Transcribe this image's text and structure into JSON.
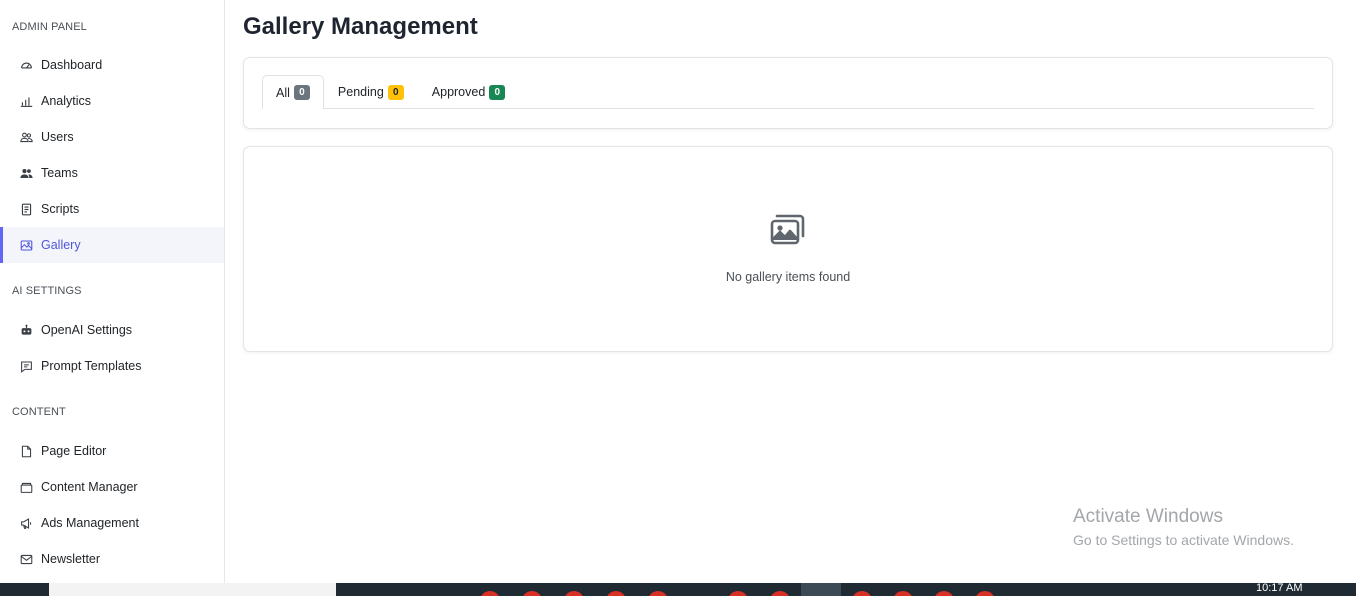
{
  "sidebar": {
    "sections": [
      {
        "title": "ADMIN PANEL"
      },
      {
        "title": "AI SETTINGS"
      },
      {
        "title": "CONTENT"
      }
    ],
    "items": [
      {
        "label": "Dashboard",
        "icon": "dashboard-icon"
      },
      {
        "label": "Analytics",
        "icon": "analytics-icon"
      },
      {
        "label": "Users",
        "icon": "users-icon"
      },
      {
        "label": "Teams",
        "icon": "teams-icon"
      },
      {
        "label": "Scripts",
        "icon": "scripts-icon"
      },
      {
        "label": "Gallery",
        "icon": "gallery-icon",
        "active": true
      },
      {
        "label": "OpenAI Settings",
        "icon": "robot-icon"
      },
      {
        "label": "Prompt Templates",
        "icon": "chat-icon"
      },
      {
        "label": "Page Editor",
        "icon": "page-icon"
      },
      {
        "label": "Content Manager",
        "icon": "folder-icon"
      },
      {
        "label": "Ads Management",
        "icon": "megaphone-icon"
      },
      {
        "label": "Newsletter",
        "icon": "envelope-icon"
      }
    ]
  },
  "main": {
    "title": "Gallery Management",
    "tabs": [
      {
        "label": "All",
        "count": "0",
        "active": true
      },
      {
        "label": "Pending",
        "count": "0"
      },
      {
        "label": "Approved",
        "count": "0"
      }
    ],
    "empty_message": "No gallery items found"
  },
  "watermark": {
    "line1": "Activate Windows",
    "line2": "Go to Settings to activate Windows."
  },
  "taskbar": {
    "time": "10:17 AM"
  },
  "colors": {
    "accent": "#6366f1",
    "badge_gray": "#6c757d",
    "badge_yellow": "#ffc107",
    "badge_green": "#198754"
  }
}
